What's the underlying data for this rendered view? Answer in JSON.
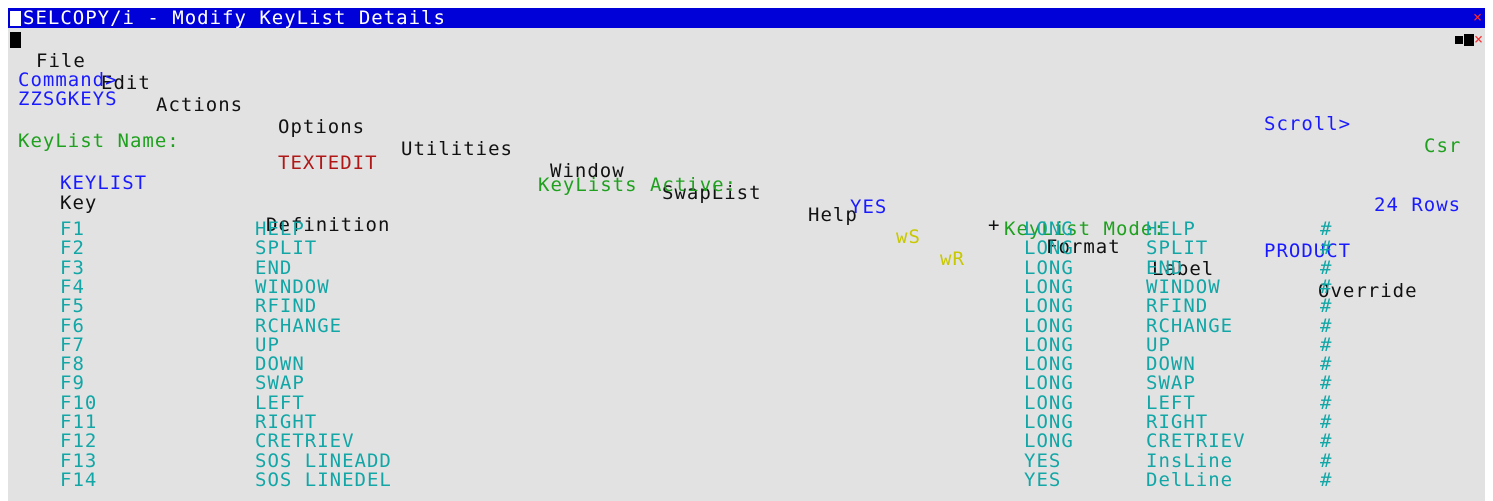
{
  "window": {
    "title": "SELCOPY/i - Modify KeyList Details",
    "close_glyph": "×"
  },
  "menu": {
    "items": [
      "File",
      "Edit",
      "Actions",
      "Options",
      "Utilities",
      "Window",
      "SwapList",
      "Help"
    ],
    "extra": [
      "wS",
      "wR"
    ]
  },
  "command": {
    "label": "Command>",
    "value": ""
  },
  "scroll": {
    "label": "Scroll>",
    "value": "Csr"
  },
  "panel_id": "ZZSGKEYS",
  "info": {
    "name_label": "KeyList Name:",
    "name_value": "TEXTEDIT",
    "active_label": "KeyLists Active:",
    "active_value": "YES",
    "mode_label": "KeyList Mode:",
    "mode_value": "PRODUCT"
  },
  "table": {
    "caption": "KEYLIST",
    "rows_count": "24 Rows",
    "more_indicator": "+",
    "headers": {
      "key": "Key",
      "definition": "Definition",
      "format": "Format",
      "label": "Label",
      "override": "Override"
    },
    "rows": [
      {
        "key": "F1",
        "definition": "HELP",
        "format": "LONG",
        "label": "HELP",
        "override": "#"
      },
      {
        "key": "F2",
        "definition": "SPLIT",
        "format": "LONG",
        "label": "SPLIT",
        "override": "#"
      },
      {
        "key": "F3",
        "definition": "END",
        "format": "LONG",
        "label": "END",
        "override": "#"
      },
      {
        "key": "F4",
        "definition": "WINDOW",
        "format": "LONG",
        "label": "WINDOW",
        "override": "#"
      },
      {
        "key": "F5",
        "definition": "RFIND",
        "format": "LONG",
        "label": "RFIND",
        "override": "#"
      },
      {
        "key": "F6",
        "definition": "RCHANGE",
        "format": "LONG",
        "label": "RCHANGE",
        "override": "#"
      },
      {
        "key": "F7",
        "definition": "UP",
        "format": "LONG",
        "label": "UP",
        "override": "#"
      },
      {
        "key": "F8",
        "definition": "DOWN",
        "format": "LONG",
        "label": "DOWN",
        "override": "#"
      },
      {
        "key": "F9",
        "definition": "SWAP",
        "format": "LONG",
        "label": "SWAP",
        "override": "#"
      },
      {
        "key": "F10",
        "definition": "LEFT",
        "format": "LONG",
        "label": "LEFT",
        "override": "#"
      },
      {
        "key": "F11",
        "definition": "RIGHT",
        "format": "LONG",
        "label": "RIGHT",
        "override": "#"
      },
      {
        "key": "F12",
        "definition": "CRETRIEV",
        "format": "LONG",
        "label": "CRETRIEV",
        "override": "#"
      },
      {
        "key": "F13",
        "definition": "SOS LINEADD",
        "format": "YES",
        "label": "InsLine",
        "override": "#"
      },
      {
        "key": "F14",
        "definition": "SOS LINEDEL",
        "format": "YES",
        "label": "DelLine",
        "override": "#"
      }
    ]
  }
}
